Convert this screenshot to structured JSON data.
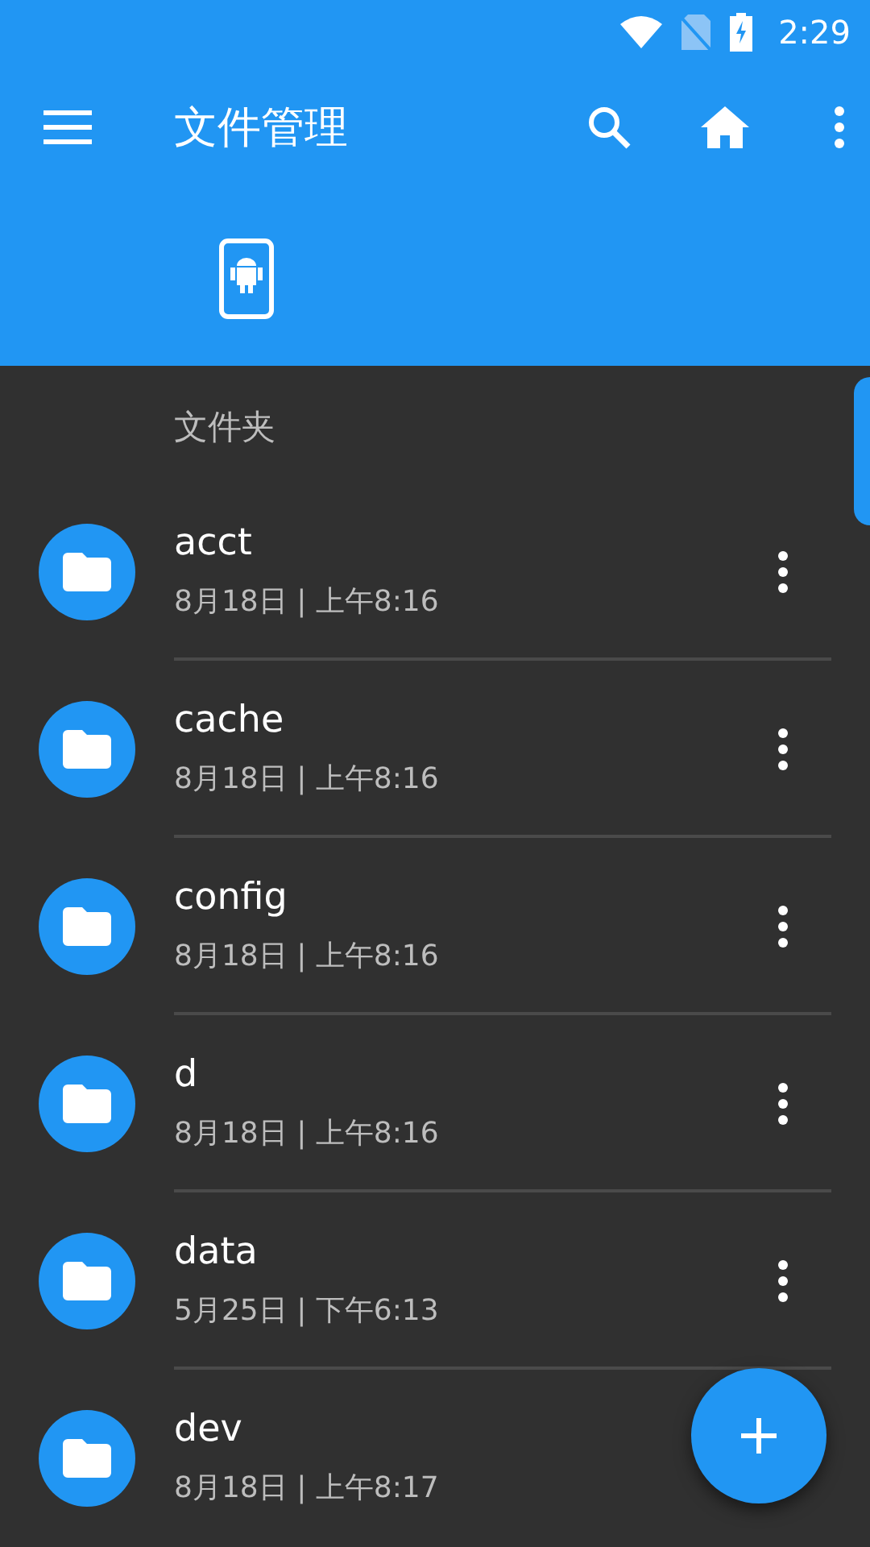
{
  "status_bar": {
    "time": "2:29"
  },
  "toolbar": {
    "title": "文件管理"
  },
  "section": {
    "title": "文件夹"
  },
  "items": [
    {
      "name": "acct",
      "date": "8月18日 | 上午8:16"
    },
    {
      "name": "cache",
      "date": "8月18日 | 上午8:16"
    },
    {
      "name": "config",
      "date": "8月18日 | 上午8:16"
    },
    {
      "name": "d",
      "date": "8月18日 | 上午8:16"
    },
    {
      "name": "data",
      "date": "5月25日 | 下午6:13"
    },
    {
      "name": "dev",
      "date": "8月18日 | 上午8:17"
    }
  ]
}
